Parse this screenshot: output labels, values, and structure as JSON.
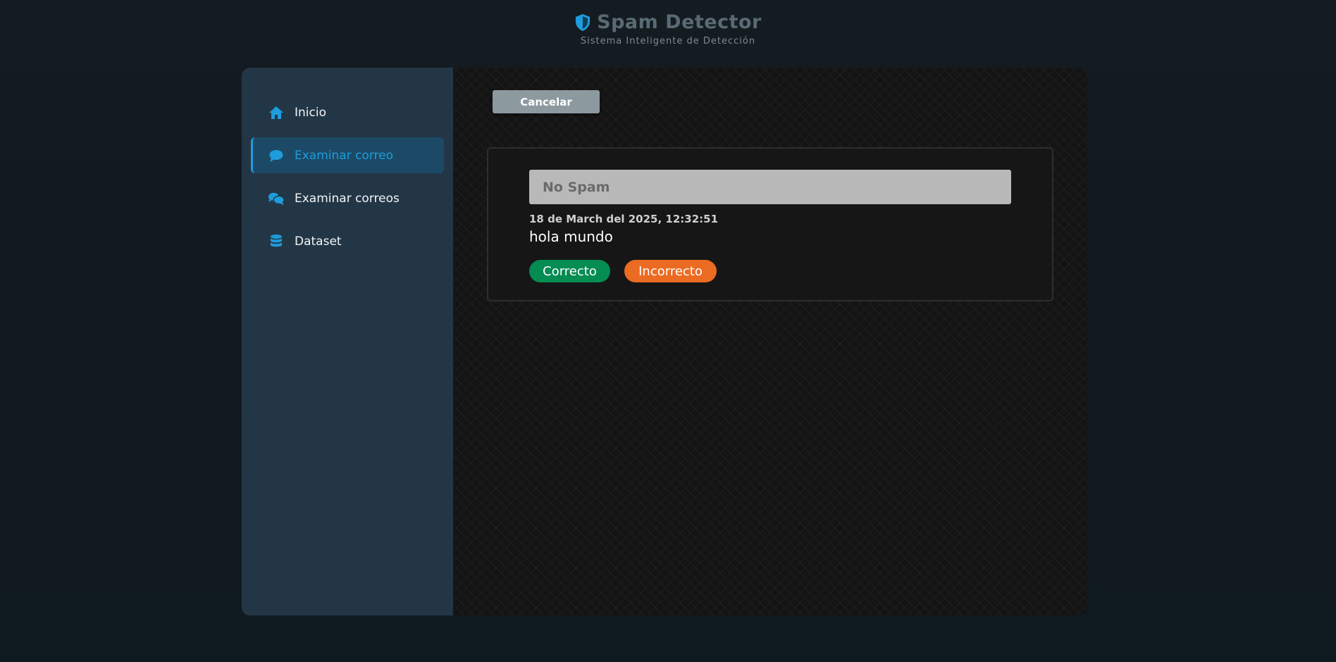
{
  "header": {
    "title": "Spam Detector",
    "subtitle": "Sistema Inteligente de Detección",
    "logo_icon": "shield-icon"
  },
  "sidebar": {
    "items": [
      {
        "label": "Inicio",
        "icon": "home-icon",
        "active": false
      },
      {
        "label": "Examinar correo",
        "icon": "comment-icon",
        "active": true
      },
      {
        "label": "Examinar correos",
        "icon": "comments-icon",
        "active": false
      },
      {
        "label": "Dataset",
        "icon": "database-icon",
        "active": false
      }
    ]
  },
  "main": {
    "cancel_label": "Cancelar",
    "result": {
      "label": "No Spam",
      "timestamp": "18 de March del 2025, 12:32:51",
      "message": "hola mundo",
      "correct_label": "Correcto",
      "incorrect_label": "Incorrecto"
    }
  },
  "colors": {
    "accent": "#1e9cdb",
    "sidebar_bg": "#233646",
    "active_bg": "#1c4a66",
    "correct": "#058c52",
    "incorrect": "#ec6b22",
    "cancel": "#8c9a9f",
    "result_bg": "#b9b9b9"
  }
}
